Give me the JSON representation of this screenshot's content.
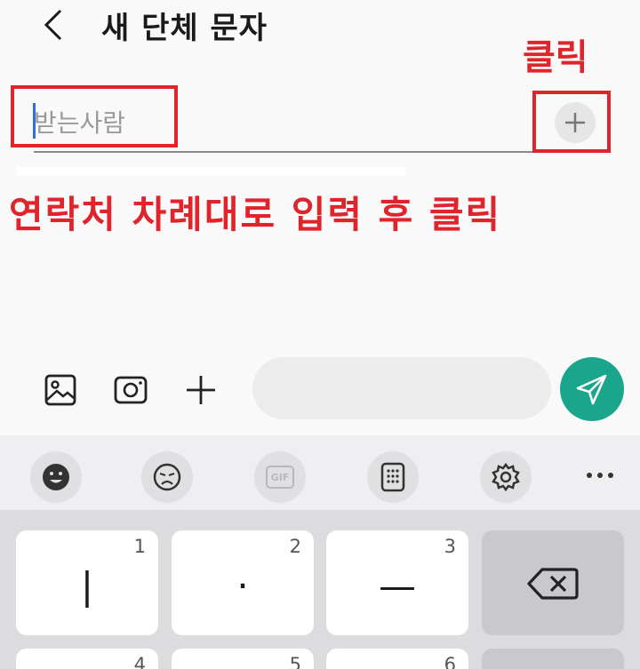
{
  "header": {
    "title": "새 단체 문자"
  },
  "recipient": {
    "placeholder": "받는사람"
  },
  "annotations": {
    "click_label": "클릭",
    "instruction": "연락처 차례대로 입력 후 클릭",
    "color": "#e0242c"
  },
  "compose": {
    "icons": [
      "gallery-icon",
      "camera-icon",
      "plus-icon"
    ],
    "send_color": "#19a68c"
  },
  "keyboard_toolbar": {
    "items": [
      "emoji-icon",
      "sticker-icon",
      "gif-icon",
      "keypad-icon",
      "settings-icon",
      "more-icon"
    ],
    "gif_label": "GIF"
  },
  "keyboard": {
    "row1": [
      {
        "digit": "1",
        "glyph": "|"
      },
      {
        "digit": "2",
        "glyph": "·"
      },
      {
        "digit": "3",
        "glyph": "—"
      }
    ],
    "row2_digits": [
      "4",
      "5",
      "6"
    ]
  }
}
